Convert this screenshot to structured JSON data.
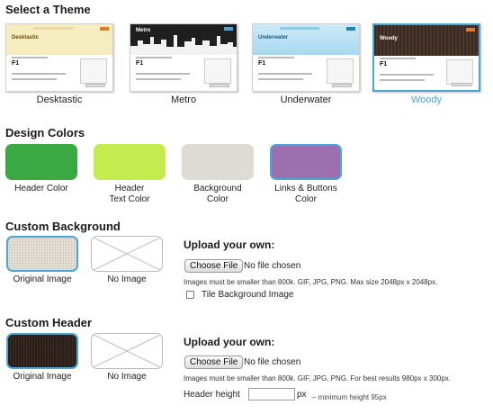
{
  "sections": {
    "theme_title": "Select a Theme",
    "colors_title": "Design Colors",
    "background_title": "Custom Background",
    "header_title": "Custom Header"
  },
  "themes": [
    {
      "label": "Desktastic",
      "header_title": "Desktastic",
      "selected": false,
      "header_color": "#f5edc0",
      "title_color": "#6a4a10"
    },
    {
      "label": "Metro",
      "header_title": "Metro",
      "selected": false,
      "header_color": "#1f1f1f",
      "title_color": "#ffffff"
    },
    {
      "label": "Underwater",
      "header_title": "Underwater",
      "selected": false,
      "header_color": "#bfe4f4",
      "title_color": "#1e5a80"
    },
    {
      "label": "Woody",
      "header_title": "Woody",
      "selected": true,
      "header_color": "#3a2a22",
      "title_color": "#ffffff"
    }
  ],
  "theme_thumb": {
    "f1": "F1"
  },
  "colors": [
    {
      "label": "Header Color",
      "value": "#3aa843",
      "selected": false
    },
    {
      "label": "Header Text Color",
      "value": "#c4ec4f",
      "selected": false
    },
    {
      "label": "Background Color",
      "value": "#dedad4",
      "selected": false
    },
    {
      "label": "Links & Buttons Color",
      "value": "#9c6fae",
      "selected": true
    }
  ],
  "background": {
    "options": [
      {
        "label": "Original Image",
        "selected": true
      },
      {
        "label": "No Image",
        "selected": false
      }
    ],
    "upload_title": "Upload your own:",
    "choose_file": "Choose File",
    "file_status": "No file chosen",
    "hint": "Images must be smaller than 800k. GIF, JPG, PNG. Max size 2048px x 2048px.",
    "tile_label": "Tile Background Image",
    "tile_checked": false
  },
  "header": {
    "options": [
      {
        "label": "Original Image",
        "selected": false
      },
      {
        "label": "No Image",
        "selected": false
      }
    ],
    "upload_title": "Upload your own:",
    "choose_file": "Choose File",
    "file_status": "No file chosen",
    "hint": "Images must be smaller than 800k. GIF, JPG, PNG. For best results 980px x 300px.",
    "height_label": "Header height",
    "height_value": "",
    "height_unit": "px",
    "height_min": "– minimum height 95px"
  },
  "accent_color": "#4aa6d8"
}
